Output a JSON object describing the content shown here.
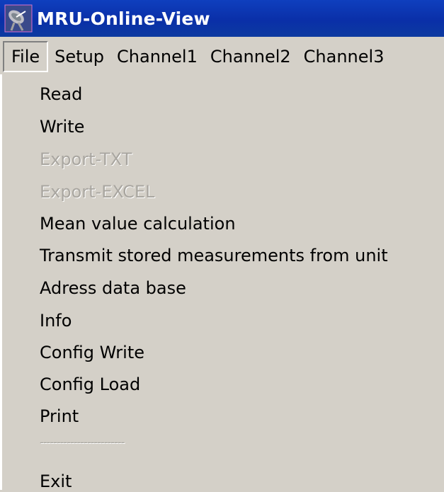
{
  "window": {
    "title": "MRU-Online-View",
    "icon": "satellite-dish-icon"
  },
  "menubar": {
    "items": [
      "File",
      "Setup",
      "Channel1",
      "Channel2",
      "Channel3"
    ],
    "active": "File"
  },
  "file_menu": {
    "items": [
      {
        "label": "Read",
        "enabled": true
      },
      {
        "label": "Write",
        "enabled": true
      },
      {
        "label": "Export-TXT",
        "enabled": false
      },
      {
        "label": "Export-EXCEL",
        "enabled": false
      },
      {
        "label": "Mean value calculation",
        "enabled": true
      },
      {
        "label": "Transmit stored measurements from unit",
        "enabled": true
      },
      {
        "label": "Adress data base",
        "enabled": true
      },
      {
        "label": "Info",
        "enabled": true
      },
      {
        "label": "Config Write",
        "enabled": true
      },
      {
        "label": "Config Load",
        "enabled": true
      },
      {
        "label": "Print",
        "enabled": true
      },
      {
        "label": "-------------------------",
        "enabled": false,
        "separator": true
      },
      {
        "label": "Exit",
        "enabled": true
      }
    ]
  },
  "colors": {
    "titlebar": "#0a2fa8",
    "menu_background": "#d4d0c8",
    "disabled_text": "#a9a6a0"
  }
}
